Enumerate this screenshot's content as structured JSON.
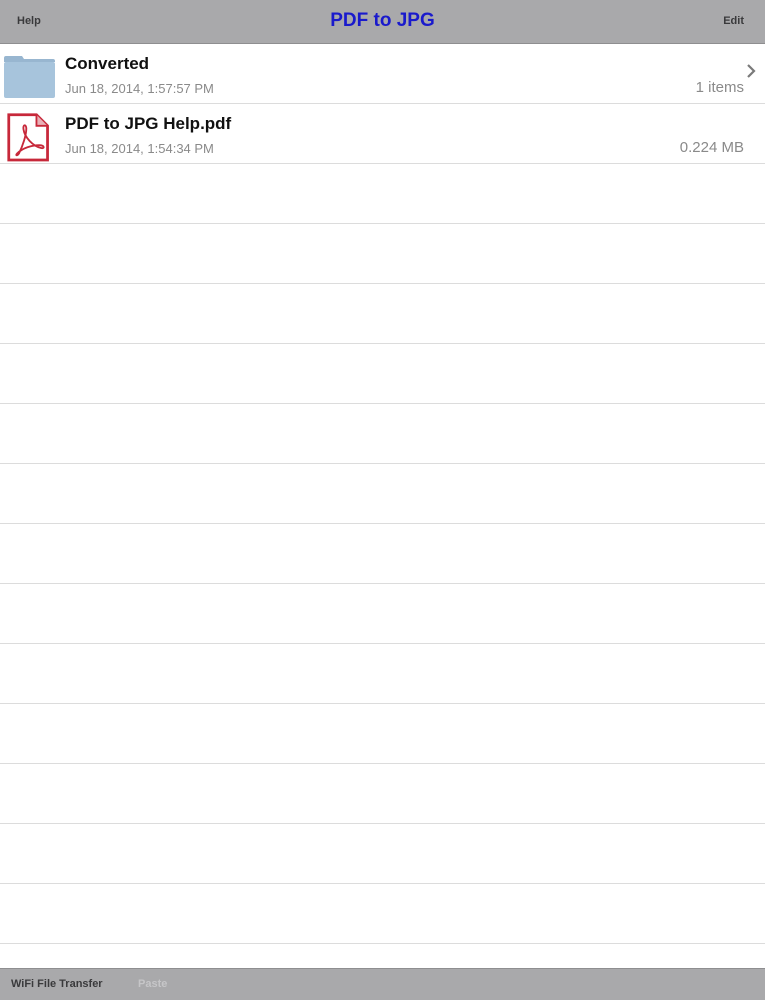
{
  "navbar": {
    "left_button": "Help",
    "title": "PDF to JPG",
    "right_button": "Edit",
    "title_color": "#1a1acc"
  },
  "files": [
    {
      "name": "Converted",
      "date": "Jun 18, 2014, 1:57:57 PM",
      "detail": "1 items",
      "icon": "folder-icon",
      "has_chevron": true
    },
    {
      "name": "PDF to JPG Help.pdf",
      "date": "Jun 18, 2014, 1:54:34 PM",
      "detail": "0.224 MB",
      "icon": "pdf-file-icon",
      "has_chevron": false
    }
  ],
  "toolbar": {
    "wifi_label": "WiFi File Transfer",
    "paste_label": "Paste"
  },
  "colors": {
    "bar_background": "#a9a9ab",
    "folder": "#a7c4dc",
    "pdf_red": "#c7283a"
  }
}
